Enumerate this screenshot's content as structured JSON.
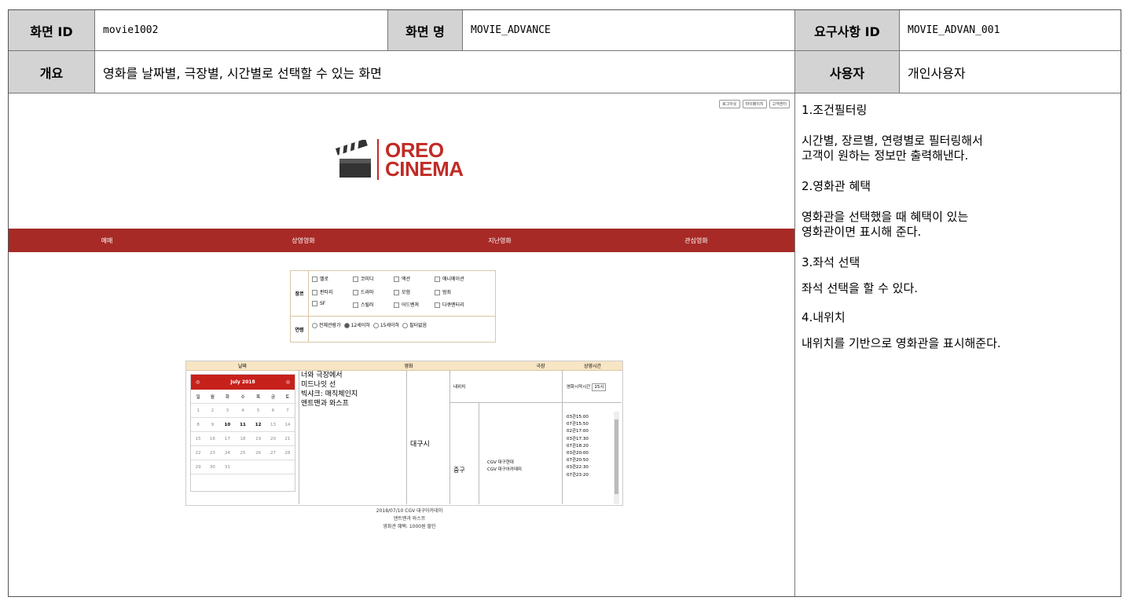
{
  "header": {
    "screen_id_label": "화면 ID",
    "screen_id_value": "movie1002",
    "screen_name_label": "화면 명",
    "screen_name_value": "MOVIE_ADVANCE",
    "req_id_label": "요구사항 ID",
    "req_id_value": "MOVIE_ADVAN_001",
    "overview_label": "개요",
    "overview_value": "영화를 날짜별, 극장별, 시간별로 선택할 수 있는 화면",
    "user_label": "사용자",
    "user_value": "개인사용자"
  },
  "description": [
    "1.조건필터링",
    "시간별, 장르별, 연령별로 필터링해서\n고객이 원하는 정보만 출력해낸다.",
    "2.영화관 혜택",
    "영화관을 선택했을 때 혜택이 있는\n 영화관이면 표시해 준다.",
    "3.좌석 선택",
    " 좌석 선택을 할 수 있다.",
    "4.내위치",
    " 내위치를 기반으로 영화관을 표시해준다."
  ],
  "mockup": {
    "top_links": [
      "로그아웃",
      "마이페이지",
      "고객센터"
    ],
    "logo_line1": "OREO",
    "logo_line2": "CINEMA",
    "nav": [
      "예매",
      "상영영화",
      "지난영화",
      "관심영화"
    ],
    "genre_label": "장르",
    "genres": [
      "멜로",
      "코미디",
      "액션",
      "애니메이션",
      "판타지",
      "드라마",
      "모험",
      "범죄",
      "SF",
      "스릴러",
      "어드벤쳐",
      "다큐멘터리"
    ],
    "age_label": "연령",
    "ages": [
      {
        "label": "전체관람가",
        "selected": false
      },
      {
        "label": "12세이하",
        "selected": true
      },
      {
        "label": "15세이하",
        "selected": false
      },
      {
        "label": "필터없음",
        "selected": false
      }
    ],
    "booking_headers": [
      "날짜",
      "영화",
      "극장",
      "상영시간"
    ],
    "calendar_month": "July 2018",
    "calendar_prev": "◎",
    "calendar_next": "◎",
    "weekdays": [
      "일",
      "월",
      "화",
      "수",
      "목",
      "금",
      "토"
    ],
    "calendar_weeks": [
      [
        "1",
        "2",
        "3",
        "4",
        "5",
        "6",
        "7"
      ],
      [
        "8",
        "9",
        "10",
        "11",
        "12",
        "13",
        "14"
      ],
      [
        "15",
        "16",
        "17",
        "18",
        "19",
        "20",
        "21"
      ],
      [
        "22",
        "23",
        "24",
        "25",
        "26",
        "27",
        "28"
      ],
      [
        "29",
        "30",
        "31",
        "",
        "",
        "",
        ""
      ]
    ],
    "calendar_bold_days": [
      "10",
      "11",
      "12"
    ],
    "movies": [
      "너와 극장에서",
      "미드나잇 선",
      "빅샤크: 매직체인지",
      "앤트맨과 와스프"
    ],
    "city": "대구시",
    "my_location": "내위치",
    "district": "중구",
    "theaters": [
      "CGV 대구현대",
      "CGV 대구아카데미"
    ],
    "time_label": "영화시작시간",
    "time_value": "15시",
    "times": [
      "03관15:00",
      "07관15:50",
      "02관17:00",
      "03관17:30",
      "07관18:20",
      "03관20:00",
      "07관20:50",
      "03관22:30",
      "07관23:20"
    ],
    "summary": [
      "2018/07/10 CGV 대구아카데미",
      "앤트맨과 와스프",
      "영화관 혜택: 1000원 할인"
    ]
  }
}
